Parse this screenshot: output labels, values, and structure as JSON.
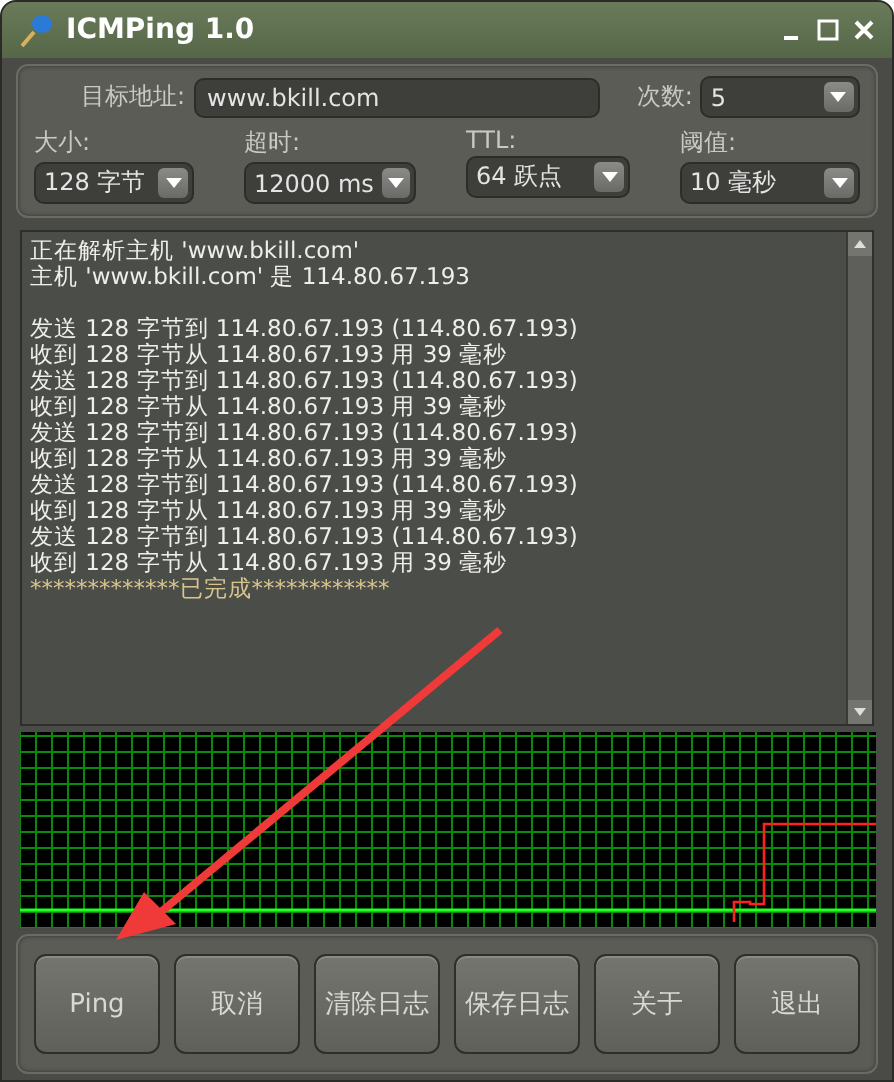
{
  "window": {
    "title": "ICMPing 1.0"
  },
  "target": {
    "label": "目标地址:",
    "value": "www.bkill.com"
  },
  "count": {
    "label": "次数:",
    "value": "5"
  },
  "options": [
    {
      "label": "大小:",
      "value": "128 字节"
    },
    {
      "label": "超时:",
      "value": "12000 ms"
    },
    {
      "label": "TTL:",
      "value": "64 跃点"
    },
    {
      "label": "阈值:",
      "value": "10 毫秒"
    }
  ],
  "log": [
    {
      "kind": "info",
      "text": "正在解析主机 'www.bkill.com'"
    },
    {
      "kind": "info",
      "text": "主机 'www.bkill.com' 是 114.80.67.193"
    },
    {
      "kind": "blank"
    },
    {
      "kind": "info",
      "text": "发送 128 字节到 114.80.67.193 (114.80.67.193)"
    },
    {
      "kind": "info",
      "text": "收到 128 字节从 114.80.67.193 用 39 毫秒"
    },
    {
      "kind": "info",
      "text": "发送 128 字节到 114.80.67.193 (114.80.67.193)"
    },
    {
      "kind": "info",
      "text": "收到 128 字节从 114.80.67.193 用 39 毫秒"
    },
    {
      "kind": "info",
      "text": "发送 128 字节到 114.80.67.193 (114.80.67.193)"
    },
    {
      "kind": "info",
      "text": "收到 128 字节从 114.80.67.193 用 39 毫秒"
    },
    {
      "kind": "info",
      "text": "发送 128 字节到 114.80.67.193 (114.80.67.193)"
    },
    {
      "kind": "info",
      "text": "收到 128 字节从 114.80.67.193 用 39 毫秒"
    },
    {
      "kind": "info",
      "text": "发送 128 字节到 114.80.67.193 (114.80.67.193)"
    },
    {
      "kind": "info",
      "text": "收到 128 字节从 114.80.67.193 用 39 毫秒"
    },
    {
      "kind": "status",
      "text": "*************已完成************"
    }
  ],
  "buttons": [
    "Ping",
    "取消",
    "清除日志",
    "保存日志",
    "关于",
    "退出"
  ]
}
